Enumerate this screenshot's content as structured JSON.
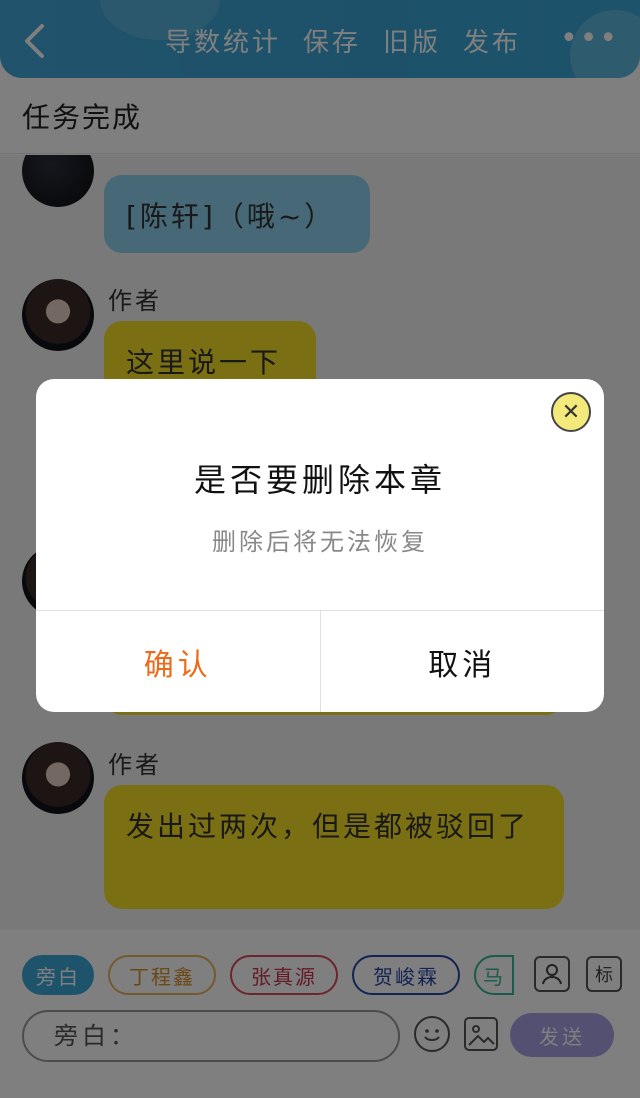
{
  "header": {
    "actions": [
      "导数统计",
      "保存",
      "旧版",
      "发布"
    ],
    "more_label": "•••"
  },
  "status": {
    "label": "任务完成"
  },
  "messages": [
    {
      "name": "",
      "text": "[陈轩]（哦~）",
      "color": "blue"
    },
    {
      "name": "作者",
      "text": "这里说一下",
      "color": "yellow"
    },
    {
      "name": "作者",
      "text": "发出过两次，但是都被驳回了",
      "color": "yellow"
    }
  ],
  "bottom": {
    "chips": [
      "旁白",
      "丁程鑫",
      "张真源",
      "贺峻霖",
      "马"
    ],
    "icon_tag_label": "标",
    "input_placeholder": "旁白：",
    "send_label": "发送"
  },
  "dialog": {
    "title": "是否要删除本章",
    "subtitle": "删除后将无法恢复",
    "confirm_label": "确认",
    "cancel_label": "取消"
  },
  "colors": {
    "accent_blue": "#3aa8d8",
    "bubble_blue": "#8ed0ee",
    "bubble_yellow": "#f5de27",
    "confirm_orange": "#ef6a1a",
    "send_purple": "#a7a0e5"
  }
}
